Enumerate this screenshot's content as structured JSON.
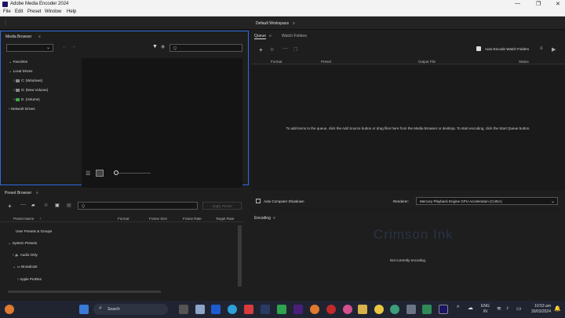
{
  "window": {
    "title": "Adobe Media Encoder 2024"
  },
  "menu": [
    "File",
    "Edit",
    "Preset",
    "Window",
    "Help"
  ],
  "workspace": {
    "title": "Default Workspace",
    "menu_glyph": "≡"
  },
  "media_browser": {
    "title": "Media Browser",
    "search_placeholder": "Q",
    "tree": [
      {
        "label": "Favorites",
        "level": 0
      },
      {
        "label": "Local Drives",
        "level": 0
      },
      {
        "label": "C: (Windows)",
        "level": 1
      },
      {
        "label": "D: (New Volume)",
        "level": 1
      },
      {
        "label": "E: (Volume)",
        "level": 1
      },
      {
        "label": "Network Drives",
        "level": 0
      }
    ]
  },
  "queue": {
    "tabs": [
      "Queue",
      "Watch Folders"
    ],
    "auto_encode_label": "Auto-Encode Watch Folders",
    "columns": [
      "Format",
      "Preset",
      "Output File",
      "Status"
    ],
    "empty_message": "To add items to the queue, click the Add Source button or drag files here from the Media Browser or desktop. To start encoding, click the Start Queue button.",
    "auto_shutdown_label": "Auto Computer Shutdown",
    "renderer_label": "Renderer:",
    "renderer_value": "Mercury Playback Engine GPU Acceleration (CUDA)"
  },
  "preset_browser": {
    "title": "Preset Browser",
    "search_placeholder": "Q",
    "apply_label": "Apply Preset",
    "columns": [
      "Preset Name",
      "Format",
      "Frame Size",
      "Frame Rate",
      "Target Rate"
    ],
    "rows": [
      {
        "label": "User Presets & Groups",
        "level": 0
      },
      {
        "label": "System Presets",
        "level": 0
      },
      {
        "label": "Audio Only",
        "level": 1
      },
      {
        "label": "Broadcast",
        "level": 1
      },
      {
        "label": "Apple ProRes",
        "level": 2
      }
    ]
  },
  "encoding": {
    "title": "Encoding",
    "message": "Not currently encoding.",
    "watermark": "Crimson Ink"
  },
  "taskbar": {
    "search_label": "Search",
    "lang_top": "ENG",
    "lang_bottom": "IN",
    "time": "10:53 am",
    "date": "30/03/2024",
    "accent": "#3a7bd5"
  }
}
